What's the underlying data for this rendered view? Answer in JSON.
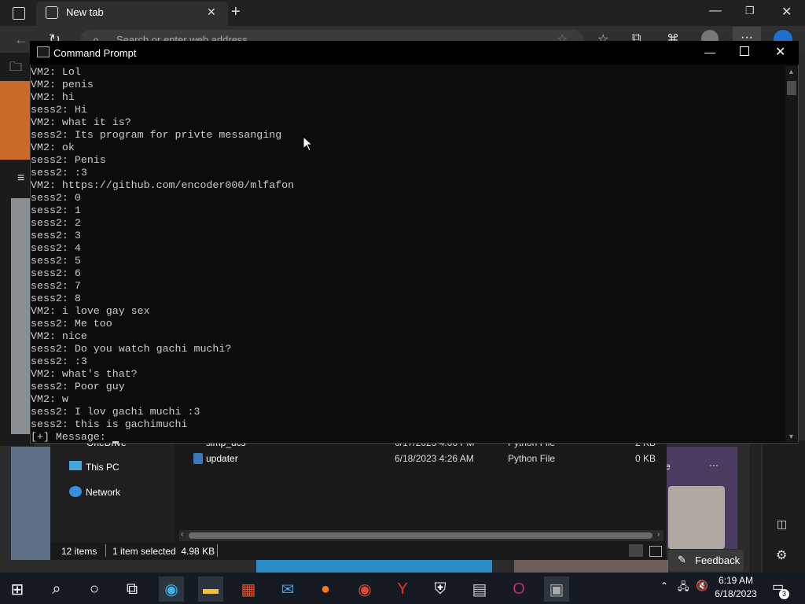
{
  "browser": {
    "tab_label": "New tab",
    "address_placeholder": "Search or enter web address",
    "feedback_label": "Feedback"
  },
  "explorer": {
    "nav": [
      "OneDrive",
      "This PC",
      "Network"
    ],
    "files": [
      {
        "name": "simp_ucs",
        "date": "6/17/2023 4:06 PM",
        "type": "Python File",
        "size": "2 KB"
      },
      {
        "name": "updater",
        "date": "6/18/2023 4:26 AM",
        "type": "Python File",
        "size": "0 KB"
      }
    ],
    "status_items": "12 items",
    "status_selected": "1 item selected  4.98 KB"
  },
  "cmd": {
    "title": "Command Prompt",
    "lines": [
      "VM2: Lol",
      "VM2: penis",
      "VM2: hi",
      "sess2: Hi",
      "VM2: what it is?",
      "sess2: Its program for privte messanging",
      "VM2: ok",
      "sess2: Penis",
      "sess2: :3",
      "VM2: https://github.com/encoder000/mlfafon",
      "sess2: 0",
      "sess2: 1",
      "sess2: 2",
      "sess2: 3",
      "sess2: 4",
      "sess2: 5",
      "sess2: 6",
      "sess2: 7",
      "sess2: 8",
      "VM2: i love gay sex",
      "sess2: Me too",
      "VM2: nice",
      "sess2: Do you watch gachi muchi?",
      "sess2: :3",
      "VM2: what's that?",
      "sess2: Poor guy",
      "VM2: w",
      "sess2: I lov gachi muchi :3",
      "sess2: this is gachimuchi"
    ],
    "prompt": "[+] Message: "
  },
  "taskbar": {
    "time": "6:19 AM",
    "date": "6/18/2023",
    "notification_count": "3"
  },
  "colors": {
    "console_bg": "#0c0c0c",
    "console_text": "#cccccc",
    "taskbar_bg": "#151a22"
  }
}
